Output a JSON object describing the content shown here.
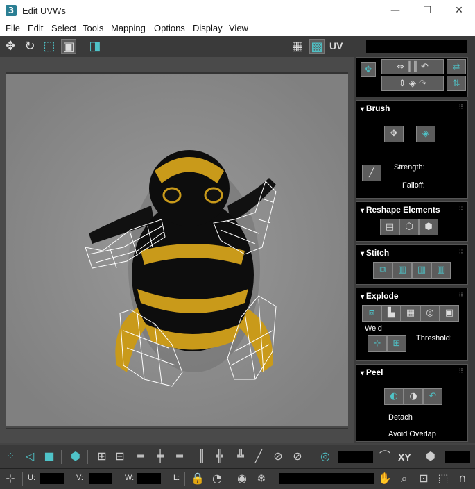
{
  "window": {
    "title": "Edit UVWs",
    "icon_text": "3",
    "minimize": "—",
    "maximize": "☐",
    "close": "✕"
  },
  "menu": [
    "File",
    "Edit",
    "Select",
    "Tools",
    "Mapping",
    "Options",
    "Display",
    "View"
  ],
  "toolbar": {
    "uv_label": "UV"
  },
  "brush": {
    "title": "Brush",
    "strength_label": "Strength:",
    "falloff_label": "Falloff:"
  },
  "reshape": {
    "title": "Reshape Elements"
  },
  "stitch": {
    "title": "Stitch"
  },
  "explode": {
    "title": "Explode",
    "weld_label": "Weld",
    "threshold_label": "Threshold:"
  },
  "peel": {
    "title": "Peel",
    "detach_label": "Detach",
    "avoid_overlap_label": "Avoid Overlap"
  },
  "bottom": {
    "xy_label": "XY",
    "u_label": "U:",
    "v_label": "V:",
    "w_label": "W:",
    "l_label": "L:"
  },
  "colors": {
    "accent": "#4fc3c8",
    "frog_body": "#0d0d0d",
    "frog_stripe": "#c99a1a",
    "viewport_bg": "#808080"
  }
}
